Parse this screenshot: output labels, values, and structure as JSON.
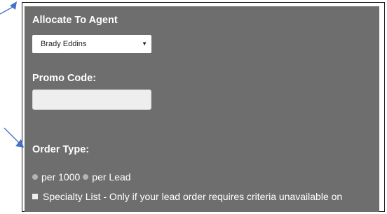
{
  "allocate": {
    "label": "Allocate To Agent",
    "selected": "Brady Eddins"
  },
  "promo": {
    "label": "Promo Code:",
    "value": ""
  },
  "order_type": {
    "label": "Order Type:",
    "option_1": "per 1000",
    "option_2": "per Lead"
  },
  "specialty": {
    "label": "Specialty List - Only if your lead order requires criteria unavailable on"
  },
  "colors": {
    "panel": "#6e6e6e",
    "annotation_arrow": "#4472c4"
  },
  "icons": [
    "dropdown-chevron-icon",
    "annotation-arrow-icon"
  ]
}
